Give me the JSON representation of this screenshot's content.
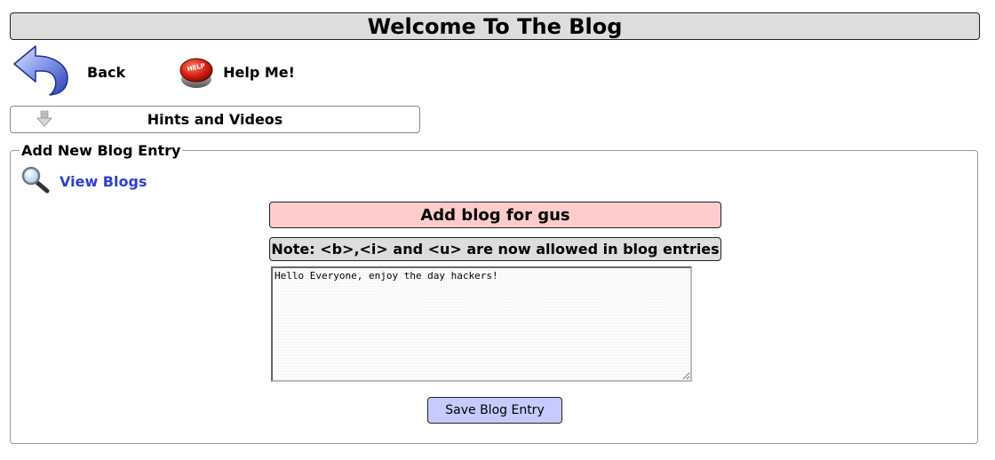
{
  "header": {
    "title": "Welcome To The Blog"
  },
  "nav": {
    "back_label": "Back",
    "help_label": "Help Me!",
    "help_icon_text": "HELP"
  },
  "hints": {
    "label": "Hints and Videos"
  },
  "form": {
    "legend": "Add New Blog Entry",
    "view_blogs_label": "View Blogs",
    "add_title": "Add blog for gus",
    "note": "Note: <b>,<i> and <u> are now allowed in blog entries",
    "entry_value": "Hello Everyone, enjoy the day hackers!",
    "save_label": "Save Blog Entry"
  },
  "colors": {
    "header_bg": "#dddddd",
    "title_bg": "#ffcccc",
    "button_bg": "#c5caff",
    "link": "#2f3fcc"
  },
  "icons": {
    "back": "back-arrow-icon",
    "help": "help-button-icon",
    "hints": "down-arrow-icon",
    "view": "magnifier-icon"
  }
}
